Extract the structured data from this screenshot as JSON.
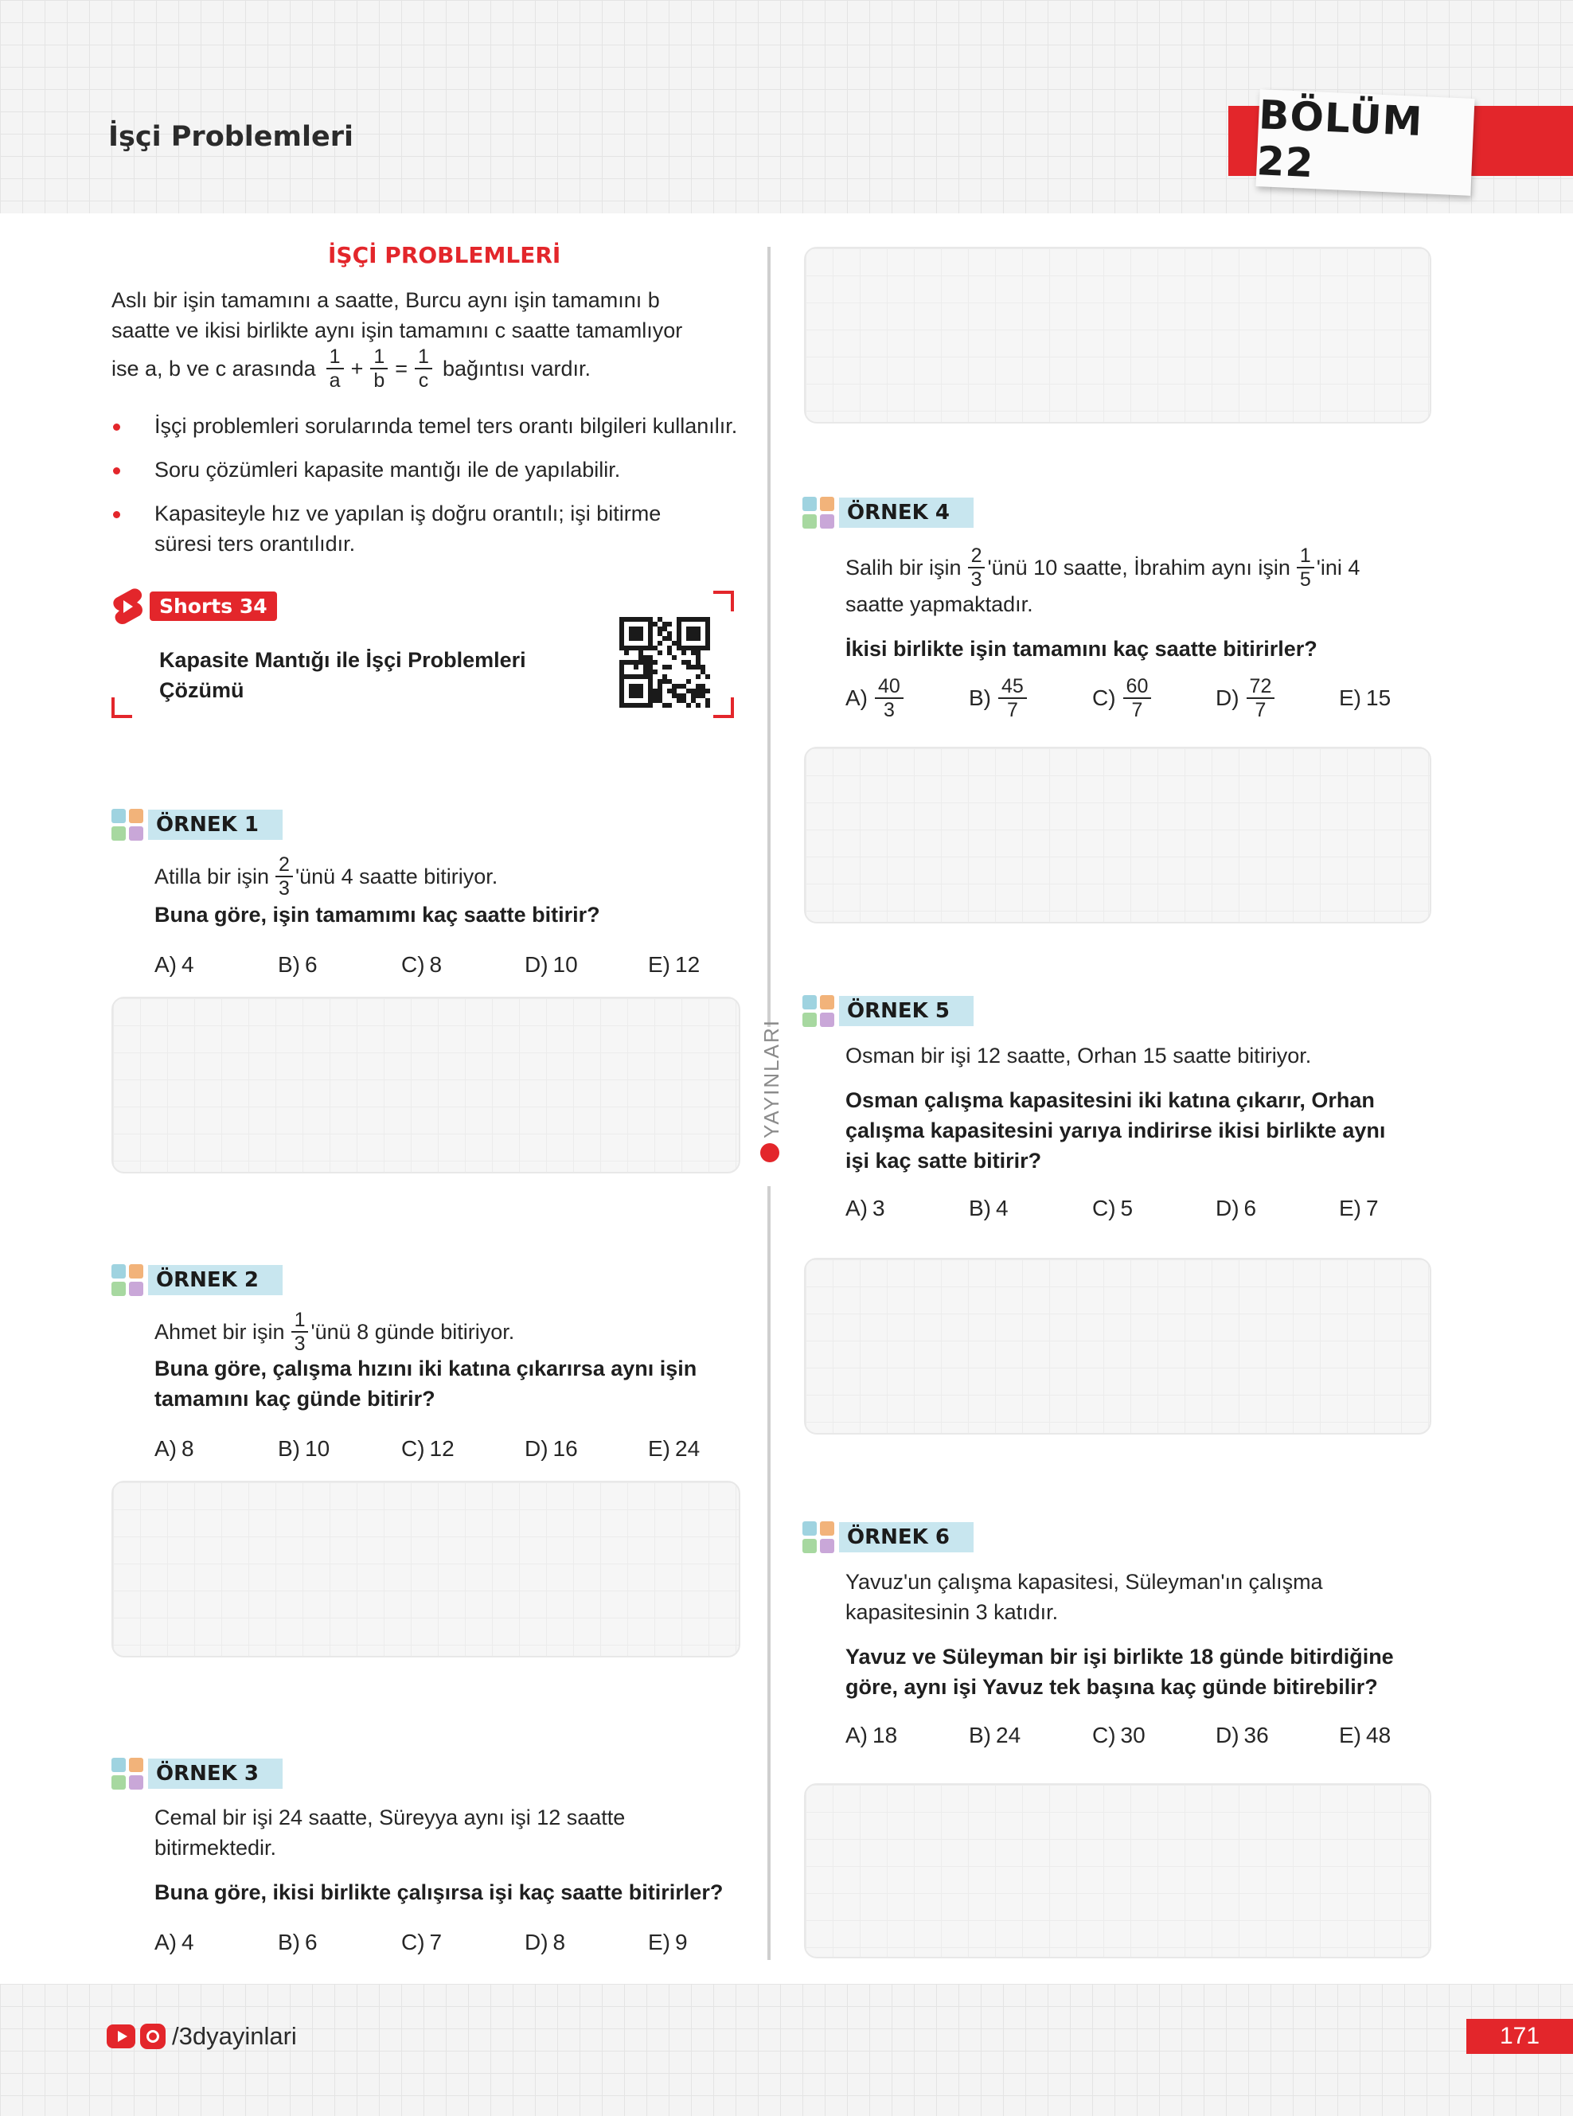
{
  "header": {
    "title": "İşçi Problemleri",
    "chapter": "BÖLÜM 22"
  },
  "intro": {
    "title": "İŞÇİ PROBLEMLERİ",
    "line1": "Aslı bir işin tamamını a saatte, Burcu aynı işin tamamını b",
    "line2": "saatte ve ikisi birlikte aynı işin tamamını c saatte tamamlıyor",
    "line3_prefix": "ise a, b ve c arasında",
    "line3_suffix": "bağıntısı vardır.",
    "bullets": [
      "İşçi problemleri sorularında temel ters orantı bilgileri kullanılır.",
      "Soru çözümleri kapasite mantığı ile de yapılabilir.",
      "Kapasiteyle hız ve yapılan iş doğru orantılı; işi bitirme",
      "süresi ters orantılıdır."
    ]
  },
  "shorts": {
    "badge": "Shorts 34",
    "title_line1": "Kapasite Mantığı ile İşçi Problemleri",
    "title_line2": "Çözümü"
  },
  "examples": {
    "e1": {
      "label": "ÖRNEK 1",
      "text_prefix": "Atilla bir işin",
      "frac_num": "2",
      "frac_den": "3",
      "text_suffix": "'ünü 4 saatte bitiriyor.",
      "question": "Buna göre, işin tamamımı kaç saatte bitirir?",
      "options": [
        [
          "A)",
          "4"
        ],
        [
          "B)",
          "6"
        ],
        [
          "C)",
          "8"
        ],
        [
          "D)",
          "10"
        ],
        [
          "E)",
          "12"
        ]
      ]
    },
    "e2": {
      "label": "ÖRNEK 2",
      "text_prefix": "Ahmet bir işin",
      "frac_num": "1",
      "frac_den": "3",
      "text_suffix": "'ünü 8 günde bitiriyor.",
      "question_line1": "Buna göre, çalışma hızını iki katına çıkarırsa aynı işin",
      "question_line2": "tamamını kaç günde bitirir?",
      "options": [
        [
          "A)",
          "8"
        ],
        [
          "B)",
          "10"
        ],
        [
          "C)",
          "12"
        ],
        [
          "D)",
          "16"
        ],
        [
          "E)",
          "24"
        ]
      ]
    },
    "e3": {
      "label": "ÖRNEK 3",
      "text_line1": "Cemal bir işi 24 saatte, Süreyya aynı işi 12 saatte",
      "text_line2": "bitirmektedir.",
      "question": "Buna göre, ikisi birlikte çalışırsa işi kaç saatte bitirirler?",
      "options": [
        [
          "A)",
          "4"
        ],
        [
          "B)",
          "6"
        ],
        [
          "C)",
          "7"
        ],
        [
          "D)",
          "8"
        ],
        [
          "E)",
          "9"
        ]
      ]
    },
    "e4": {
      "label": "ÖRNEK 4",
      "text_prefix": "Salih bir işin",
      "frac1_num": "2",
      "frac1_den": "3",
      "text_mid": "'ünü 10 saatte, İbrahim aynı işin",
      "frac2_num": "1",
      "frac2_den": "5",
      "text_suffix": "'ini 4",
      "text_line2": "saatte yapmaktadır.",
      "question": "İkisi birlikte işin tamamını kaç saatte bitirirler?",
      "options": [
        {
          "letter": "A)",
          "num": "40",
          "den": "3"
        },
        {
          "letter": "B)",
          "num": "45",
          "den": "7"
        },
        {
          "letter": "C)",
          "num": "60",
          "den": "7"
        },
        {
          "letter": "D)",
          "num": "72",
          "den": "7"
        },
        {
          "letter": "E)",
          "value": "15"
        }
      ]
    },
    "e5": {
      "label": "ÖRNEK 5",
      "text": "Osman bir işi 12 saatte, Orhan 15 saatte bitiriyor.",
      "question_line1": "Osman çalışma kapasitesini iki katına çıkarır, Orhan",
      "question_line2": "çalışma kapasitesini yarıya indirirse ikisi birlikte aynı",
      "question_line3": "işi kaç satte bitirir?",
      "options": [
        [
          "A)",
          "3"
        ],
        [
          "B)",
          "4"
        ],
        [
          "C)",
          "5"
        ],
        [
          "D)",
          "6"
        ],
        [
          "E)",
          "7"
        ]
      ]
    },
    "e6": {
      "label": "ÖRNEK 6",
      "text_line1": "Yavuz'un çalışma kapasitesi, Süleyman'ın çalışma",
      "text_line2": "kapasitesinin 3 katıdır.",
      "question_line1": "Yavuz ve Süleyman bir işi birlikte 18 günde bitirdiğine",
      "question_line2": "göre, aynı işi Yavuz tek başına kaç günde bitirebilir?",
      "options": [
        [
          "A)",
          "18"
        ],
        [
          "B)",
          "24"
        ],
        [
          "C)",
          "30"
        ],
        [
          "D)",
          "36"
        ],
        [
          "E)",
          "48"
        ]
      ]
    }
  },
  "publisher_vertical": "YAYINLARI",
  "footer": {
    "social_handle": "/3dyayinlari",
    "page_number": "171"
  },
  "colors": {
    "accent_red": "#e3262b",
    "tag_blue": "#c8e6ef"
  }
}
